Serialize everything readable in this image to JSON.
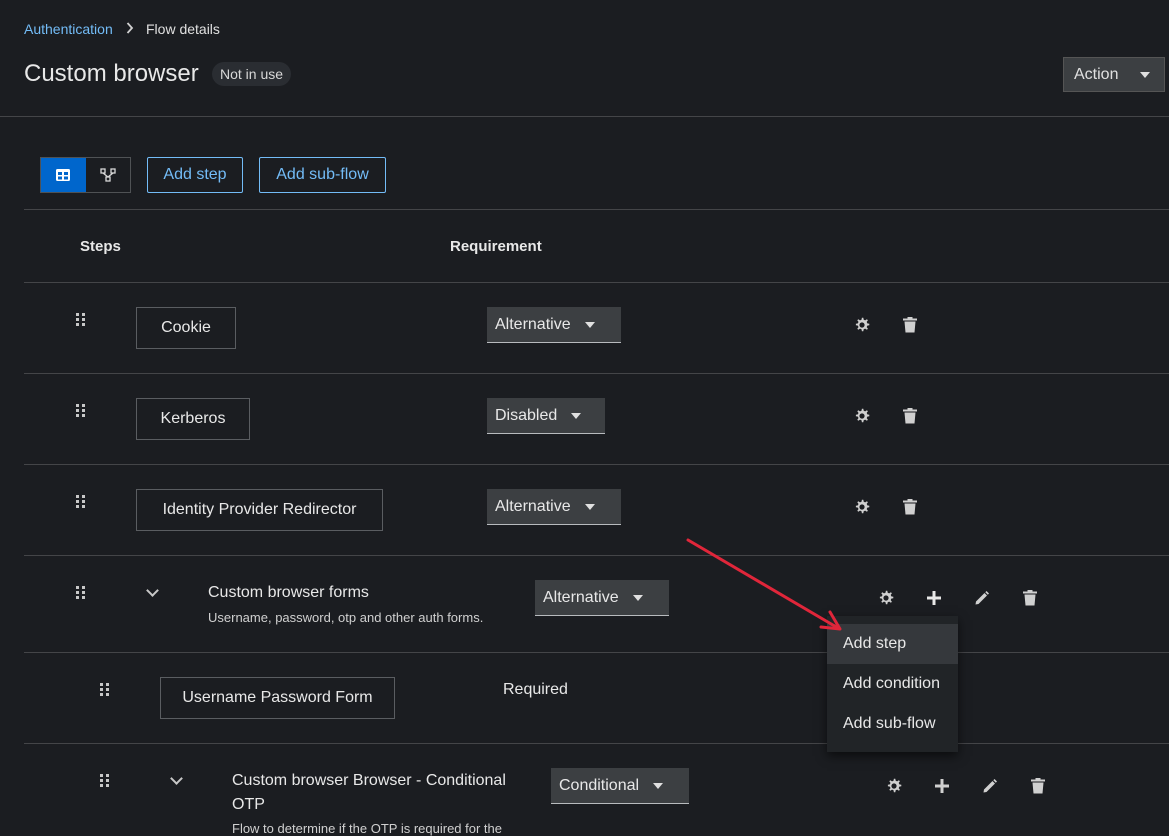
{
  "breadcrumb": {
    "parent": "Authentication",
    "separator": "›",
    "current": "Flow details"
  },
  "header": {
    "title": "Custom browser",
    "status_badge": "Not in use",
    "action_label": "Action"
  },
  "toolbar": {
    "views": [
      {
        "name": "table-view",
        "icon": "table-icon",
        "active": true
      },
      {
        "name": "diagram-view",
        "icon": "diagram-icon",
        "active": false
      }
    ],
    "add_step_label": "Add step",
    "add_subflow_label": "Add sub-flow"
  },
  "table": {
    "headers": {
      "steps": "Steps",
      "requirement": "Requirement"
    },
    "rows": [
      {
        "name": "Cookie",
        "requirement": "Alternative"
      },
      {
        "name": "Kerberos",
        "requirement": "Disabled"
      },
      {
        "name": "Identity Provider Redirector",
        "requirement": "Alternative"
      },
      {
        "name": "Custom browser forms",
        "description": "Username, password, otp and other auth forms.",
        "requirement": "Alternative"
      },
      {
        "name": "Username Password Form",
        "requirement": "Required"
      },
      {
        "name_line1": "Custom browser Browser - Conditional",
        "name_line2": "OTP",
        "description": "Flow to determine if the OTP is required for the",
        "requirement": "Conditional"
      }
    ]
  },
  "add_menu": {
    "items": [
      "Add step",
      "Add condition",
      "Add sub-flow"
    ]
  },
  "annotation": {
    "color": "#e0263a"
  },
  "colors": {
    "accent": "#73bcf7",
    "primary": "#0066cc",
    "background": "#1b1d21"
  }
}
